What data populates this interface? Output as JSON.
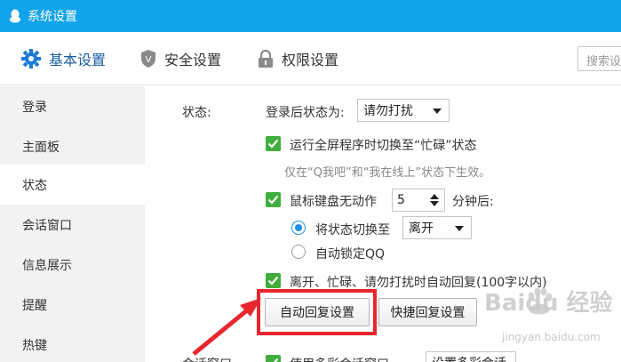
{
  "window": {
    "title": "系统设置"
  },
  "nav": {
    "tabs": [
      {
        "label": "基本设置",
        "icon": "gear-icon"
      },
      {
        "label": "安全设置",
        "icon": "shield-icon"
      },
      {
        "label": "权限设置",
        "icon": "lock-icon"
      }
    ],
    "search_placeholder": "搜索设"
  },
  "sidebar": {
    "items": [
      {
        "label": "登录"
      },
      {
        "label": "主面板"
      },
      {
        "label": "状态"
      },
      {
        "label": "会话窗口"
      },
      {
        "label": "信息展示"
      },
      {
        "label": "提醒"
      },
      {
        "label": "热键"
      }
    ]
  },
  "status": {
    "section_label": "状态:",
    "login_status_label": "登录后状态为:",
    "login_status_value": "请勿打扰",
    "fullscreen_label": "运行全屏程序时切换至“忙碌”状态",
    "fullscreen_hint": "仅在“Q我吧”和“我在线上”状态下生效。",
    "idle_label": "鼠标键盘无动作",
    "idle_minutes": "5",
    "idle_unit": "分钟后:",
    "switch_status_label": "将状态切换至",
    "switch_status_value": "离开",
    "autolock_label": "自动锁定QQ",
    "auto_reply_label": "离开、忙碌、请勿打扰时自动回复(100字以内)",
    "auto_reply_btn": "自动回复设置",
    "quick_reply_btn": "快捷回复设置"
  },
  "next_section": {
    "label": "会话窗口",
    "checkbox_label": "使用多彩会话窗口",
    "select_value": "设置多彩会话"
  },
  "watermark": {
    "brand": "Baidu 经验",
    "url": "jingyan.baidu.com"
  },
  "colors": {
    "titlebar": "#12a4ea",
    "accent": "#1a5fa6",
    "checkbox": "#3fae3c",
    "annotation": "#e8262d"
  }
}
